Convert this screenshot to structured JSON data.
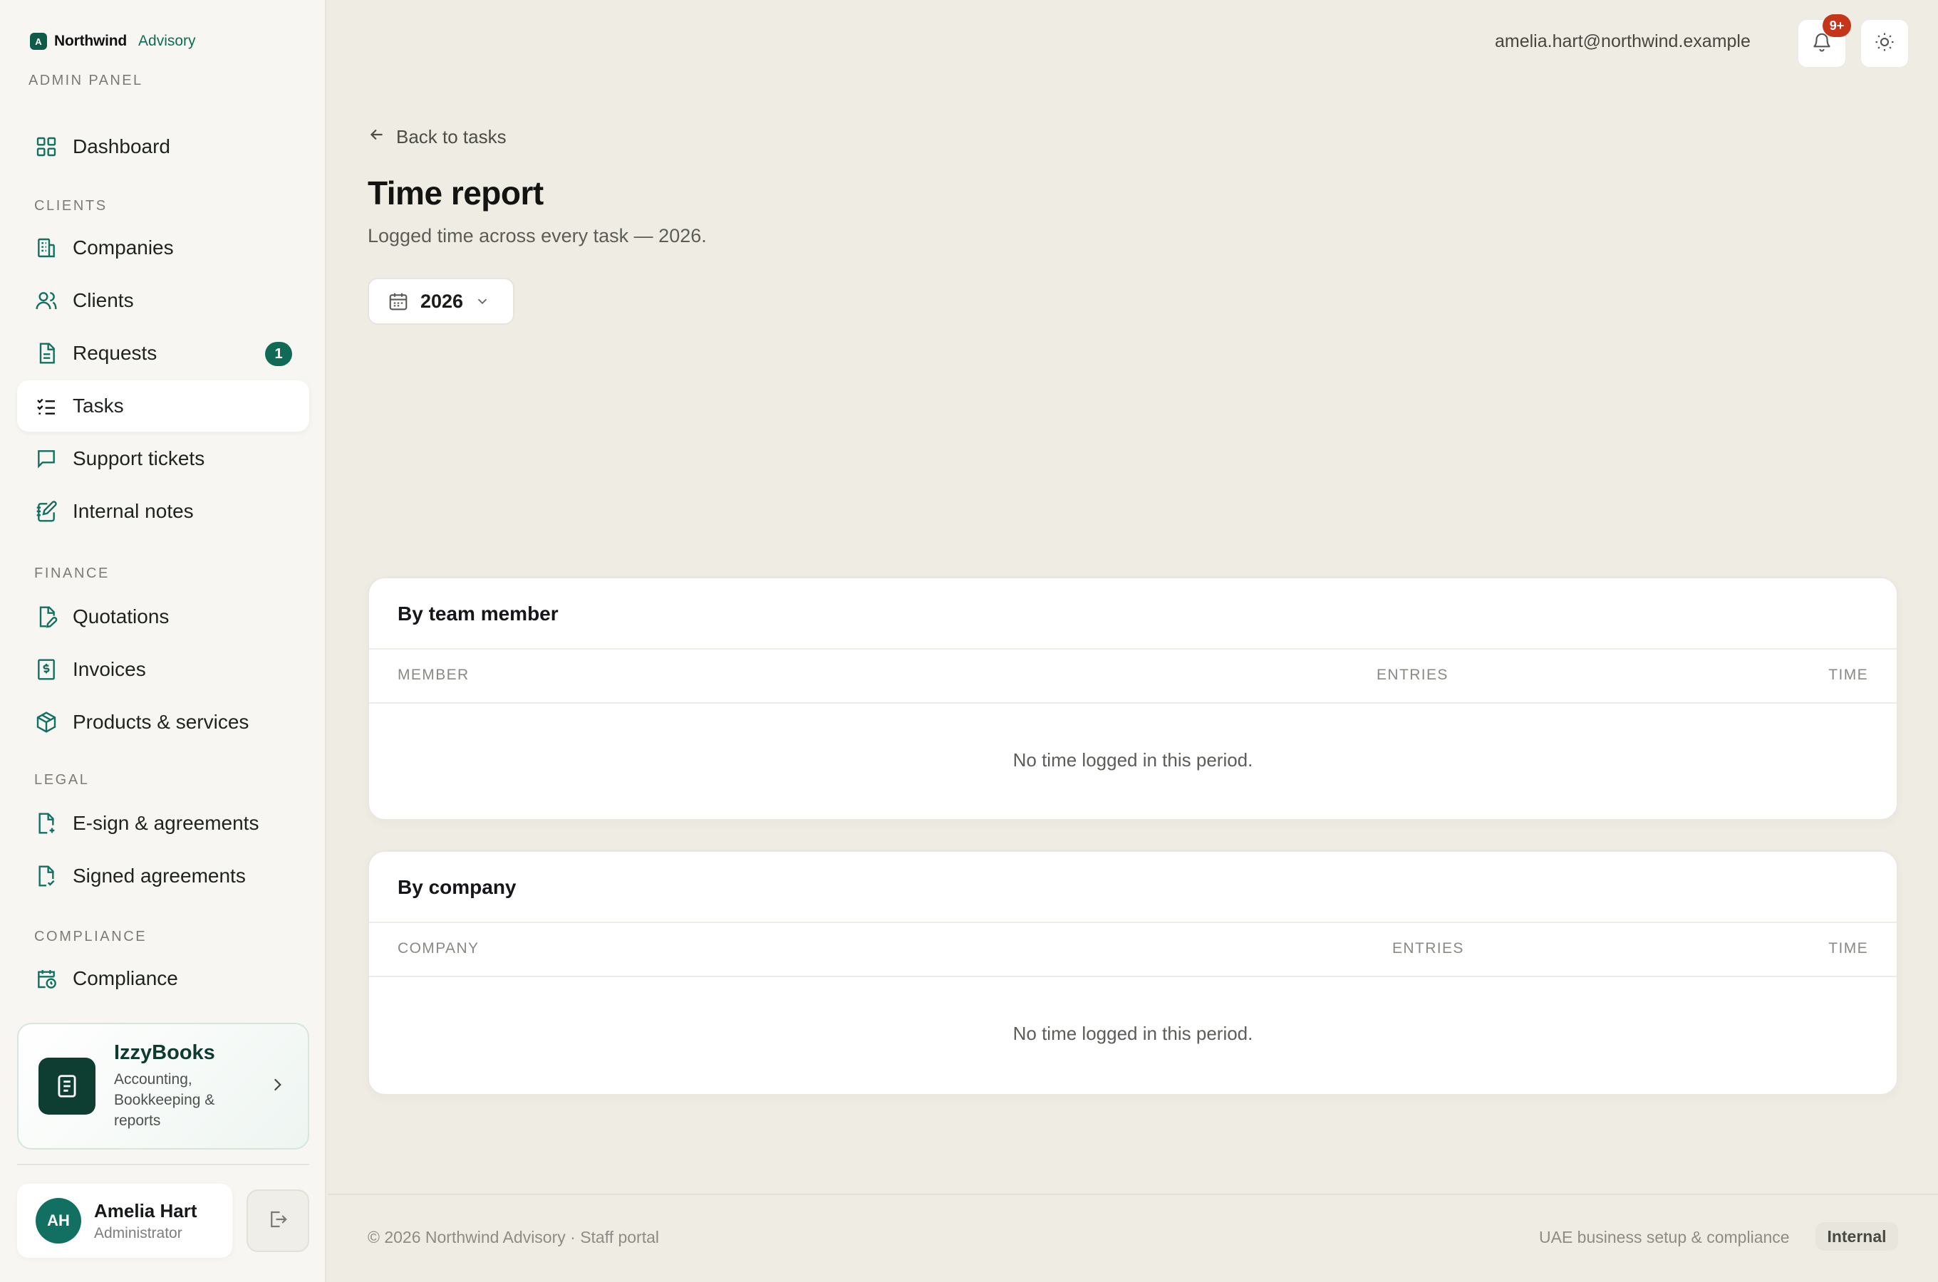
{
  "brand": {
    "logo_letter": "A",
    "name": "Northwind",
    "sub": "Advisory",
    "panel_label": "ADMIN PANEL"
  },
  "sidebar": {
    "dashboard": "Dashboard",
    "sections": {
      "clients": "CLIENTS",
      "finance": "FINANCE",
      "legal": "LEGAL",
      "compliance": "COMPLIANCE"
    },
    "items": {
      "companies": "Companies",
      "clients": "Clients",
      "requests": "Requests",
      "requests_badge": "1",
      "tasks": "Tasks",
      "support": "Support tickets",
      "notes": "Internal notes",
      "quotations": "Quotations",
      "invoices": "Invoices",
      "products": "Products & services",
      "esign": "E-sign & agreements",
      "signed": "Signed agreements",
      "compliance": "Compliance"
    },
    "promo": {
      "title": "IzzyBooks",
      "desc": "Accounting, Bookkeeping & reports"
    },
    "user": {
      "initials": "AH",
      "name": "Amelia Hart",
      "role": "Administrator"
    }
  },
  "header": {
    "email": "amelia.hart@northwind.example",
    "notif_badge": "9+"
  },
  "main": {
    "back": "Back to tasks",
    "title": "Time report",
    "subtitle": "Logged time across every task — 2026.",
    "year": "2026",
    "member_card": {
      "title": "By team member",
      "cols": [
        "MEMBER",
        "ENTRIES",
        "TIME"
      ],
      "empty": "No time logged in this period."
    },
    "company_card": {
      "title": "By company",
      "cols": [
        "COMPANY",
        "ENTRIES",
        "TIME"
      ],
      "empty": "No time logged in this period."
    }
  },
  "footer": {
    "left": "© 2026 Northwind Advisory · Staff portal",
    "right": "UAE business setup & compliance",
    "tag": "Internal"
  },
  "colors": {
    "accent": "#0f6b55",
    "badge_red": "#c4351a",
    "sidebar_bg": "#f7f6f2",
    "page_bg": "#efece4"
  }
}
